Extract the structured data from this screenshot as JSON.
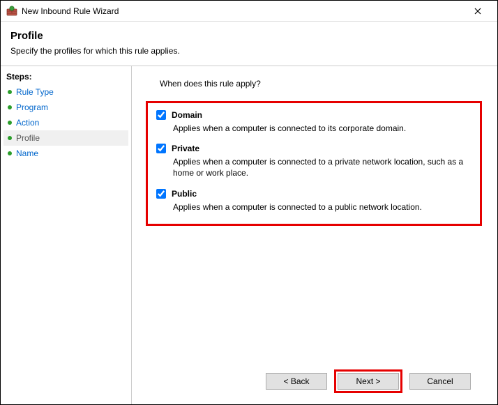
{
  "window": {
    "title": "New Inbound Rule Wizard"
  },
  "header": {
    "title": "Profile",
    "subtitle": "Specify the profiles for which this rule applies."
  },
  "sidebar": {
    "heading": "Steps:",
    "items": [
      {
        "label": "Rule Type",
        "current": false
      },
      {
        "label": "Program",
        "current": false
      },
      {
        "label": "Action",
        "current": false
      },
      {
        "label": "Profile",
        "current": true
      },
      {
        "label": "Name",
        "current": false
      }
    ]
  },
  "content": {
    "question": "When does this rule apply?",
    "options": [
      {
        "key": "domain",
        "label": "Domain",
        "checked": true,
        "description": "Applies when a computer is connected to its corporate domain."
      },
      {
        "key": "private",
        "label": "Private",
        "checked": true,
        "description": "Applies when a computer is connected to a private network location, such as a home or work place."
      },
      {
        "key": "public",
        "label": "Public",
        "checked": true,
        "description": "Applies when a computer is connected to a public network location."
      }
    ]
  },
  "footer": {
    "back": "< Back",
    "next": "Next >",
    "cancel": "Cancel"
  }
}
